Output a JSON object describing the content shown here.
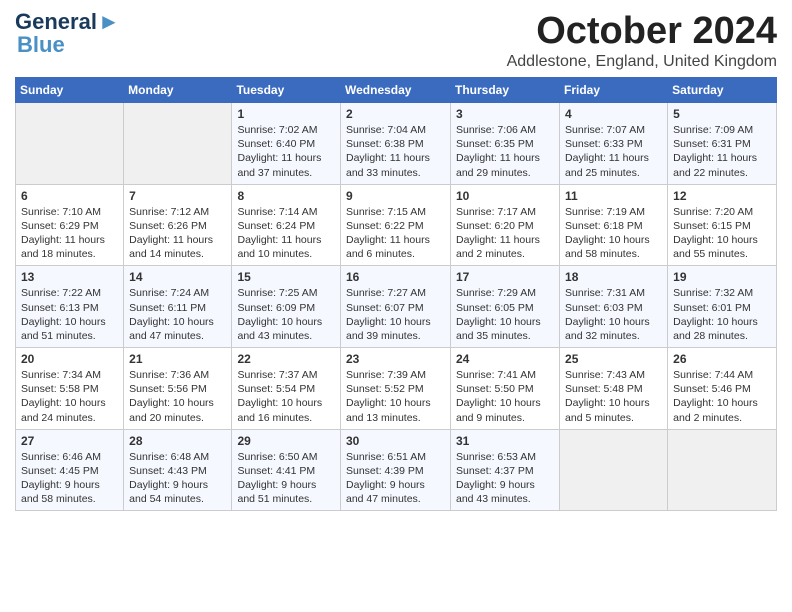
{
  "logo": {
    "line1": "General",
    "line2": "Blue"
  },
  "title": "October 2024",
  "location": "Addlestone, England, United Kingdom",
  "days_header": [
    "Sunday",
    "Monday",
    "Tuesday",
    "Wednesday",
    "Thursday",
    "Friday",
    "Saturday"
  ],
  "weeks": [
    [
      {
        "day": "",
        "sunrise": "",
        "sunset": "",
        "daylight": ""
      },
      {
        "day": "",
        "sunrise": "",
        "sunset": "",
        "daylight": ""
      },
      {
        "day": "1",
        "sunrise": "Sunrise: 7:02 AM",
        "sunset": "Sunset: 6:40 PM",
        "daylight": "Daylight: 11 hours and 37 minutes."
      },
      {
        "day": "2",
        "sunrise": "Sunrise: 7:04 AM",
        "sunset": "Sunset: 6:38 PM",
        "daylight": "Daylight: 11 hours and 33 minutes."
      },
      {
        "day": "3",
        "sunrise": "Sunrise: 7:06 AM",
        "sunset": "Sunset: 6:35 PM",
        "daylight": "Daylight: 11 hours and 29 minutes."
      },
      {
        "day": "4",
        "sunrise": "Sunrise: 7:07 AM",
        "sunset": "Sunset: 6:33 PM",
        "daylight": "Daylight: 11 hours and 25 minutes."
      },
      {
        "day": "5",
        "sunrise": "Sunrise: 7:09 AM",
        "sunset": "Sunset: 6:31 PM",
        "daylight": "Daylight: 11 hours and 22 minutes."
      }
    ],
    [
      {
        "day": "6",
        "sunrise": "Sunrise: 7:10 AM",
        "sunset": "Sunset: 6:29 PM",
        "daylight": "Daylight: 11 hours and 18 minutes."
      },
      {
        "day": "7",
        "sunrise": "Sunrise: 7:12 AM",
        "sunset": "Sunset: 6:26 PM",
        "daylight": "Daylight: 11 hours and 14 minutes."
      },
      {
        "day": "8",
        "sunrise": "Sunrise: 7:14 AM",
        "sunset": "Sunset: 6:24 PM",
        "daylight": "Daylight: 11 hours and 10 minutes."
      },
      {
        "day": "9",
        "sunrise": "Sunrise: 7:15 AM",
        "sunset": "Sunset: 6:22 PM",
        "daylight": "Daylight: 11 hours and 6 minutes."
      },
      {
        "day": "10",
        "sunrise": "Sunrise: 7:17 AM",
        "sunset": "Sunset: 6:20 PM",
        "daylight": "Daylight: 11 hours and 2 minutes."
      },
      {
        "day": "11",
        "sunrise": "Sunrise: 7:19 AM",
        "sunset": "Sunset: 6:18 PM",
        "daylight": "Daylight: 10 hours and 58 minutes."
      },
      {
        "day": "12",
        "sunrise": "Sunrise: 7:20 AM",
        "sunset": "Sunset: 6:15 PM",
        "daylight": "Daylight: 10 hours and 55 minutes."
      }
    ],
    [
      {
        "day": "13",
        "sunrise": "Sunrise: 7:22 AM",
        "sunset": "Sunset: 6:13 PM",
        "daylight": "Daylight: 10 hours and 51 minutes."
      },
      {
        "day": "14",
        "sunrise": "Sunrise: 7:24 AM",
        "sunset": "Sunset: 6:11 PM",
        "daylight": "Daylight: 10 hours and 47 minutes."
      },
      {
        "day": "15",
        "sunrise": "Sunrise: 7:25 AM",
        "sunset": "Sunset: 6:09 PM",
        "daylight": "Daylight: 10 hours and 43 minutes."
      },
      {
        "day": "16",
        "sunrise": "Sunrise: 7:27 AM",
        "sunset": "Sunset: 6:07 PM",
        "daylight": "Daylight: 10 hours and 39 minutes."
      },
      {
        "day": "17",
        "sunrise": "Sunrise: 7:29 AM",
        "sunset": "Sunset: 6:05 PM",
        "daylight": "Daylight: 10 hours and 35 minutes."
      },
      {
        "day": "18",
        "sunrise": "Sunrise: 7:31 AM",
        "sunset": "Sunset: 6:03 PM",
        "daylight": "Daylight: 10 hours and 32 minutes."
      },
      {
        "day": "19",
        "sunrise": "Sunrise: 7:32 AM",
        "sunset": "Sunset: 6:01 PM",
        "daylight": "Daylight: 10 hours and 28 minutes."
      }
    ],
    [
      {
        "day": "20",
        "sunrise": "Sunrise: 7:34 AM",
        "sunset": "Sunset: 5:58 PM",
        "daylight": "Daylight: 10 hours and 24 minutes."
      },
      {
        "day": "21",
        "sunrise": "Sunrise: 7:36 AM",
        "sunset": "Sunset: 5:56 PM",
        "daylight": "Daylight: 10 hours and 20 minutes."
      },
      {
        "day": "22",
        "sunrise": "Sunrise: 7:37 AM",
        "sunset": "Sunset: 5:54 PM",
        "daylight": "Daylight: 10 hours and 16 minutes."
      },
      {
        "day": "23",
        "sunrise": "Sunrise: 7:39 AM",
        "sunset": "Sunset: 5:52 PM",
        "daylight": "Daylight: 10 hours and 13 minutes."
      },
      {
        "day": "24",
        "sunrise": "Sunrise: 7:41 AM",
        "sunset": "Sunset: 5:50 PM",
        "daylight": "Daylight: 10 hours and 9 minutes."
      },
      {
        "day": "25",
        "sunrise": "Sunrise: 7:43 AM",
        "sunset": "Sunset: 5:48 PM",
        "daylight": "Daylight: 10 hours and 5 minutes."
      },
      {
        "day": "26",
        "sunrise": "Sunrise: 7:44 AM",
        "sunset": "Sunset: 5:46 PM",
        "daylight": "Daylight: 10 hours and 2 minutes."
      }
    ],
    [
      {
        "day": "27",
        "sunrise": "Sunrise: 6:46 AM",
        "sunset": "Sunset: 4:45 PM",
        "daylight": "Daylight: 9 hours and 58 minutes."
      },
      {
        "day": "28",
        "sunrise": "Sunrise: 6:48 AM",
        "sunset": "Sunset: 4:43 PM",
        "daylight": "Daylight: 9 hours and 54 minutes."
      },
      {
        "day": "29",
        "sunrise": "Sunrise: 6:50 AM",
        "sunset": "Sunset: 4:41 PM",
        "daylight": "Daylight: 9 hours and 51 minutes."
      },
      {
        "day": "30",
        "sunrise": "Sunrise: 6:51 AM",
        "sunset": "Sunset: 4:39 PM",
        "daylight": "Daylight: 9 hours and 47 minutes."
      },
      {
        "day": "31",
        "sunrise": "Sunrise: 6:53 AM",
        "sunset": "Sunset: 4:37 PM",
        "daylight": "Daylight: 9 hours and 43 minutes."
      },
      {
        "day": "",
        "sunrise": "",
        "sunset": "",
        "daylight": ""
      },
      {
        "day": "",
        "sunrise": "",
        "sunset": "",
        "daylight": ""
      }
    ]
  ]
}
